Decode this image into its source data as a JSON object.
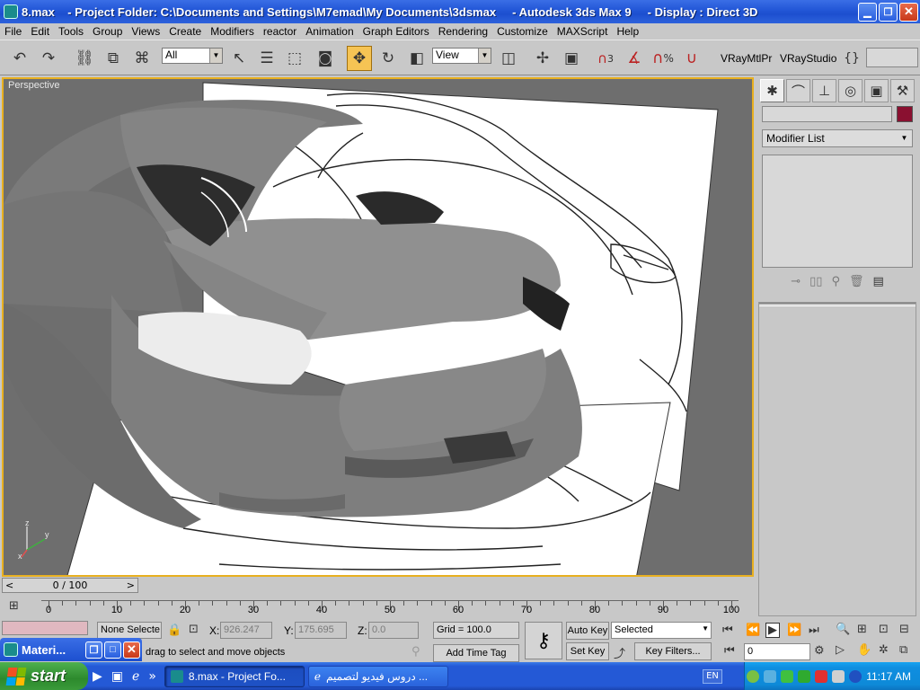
{
  "window": {
    "title": "8.max    - Project Folder: C:\\Documents and Settings\\M7emad\\My Documents\\3dsmax     - Autodesk 3ds Max 9     - Display : Direct 3D"
  },
  "menu": [
    "File",
    "Edit",
    "Tools",
    "Group",
    "Views",
    "Create",
    "Modifiers",
    "reactor",
    "Animation",
    "Graph Editors",
    "Rendering",
    "Customize",
    "MAXScript",
    "Help"
  ],
  "toolbar": {
    "selection_filter": "All",
    "reference_coord": "View",
    "vray_mtl_label": "VRayMtlPr",
    "vray_studio_label": "VRayStudio",
    "snap_angle_label": "3",
    "percent_snap_label": "%",
    "named_selection_value": ""
  },
  "viewport": {
    "label": "Perspective",
    "axis_x": "x",
    "axis_y": "y",
    "axis_z": "z",
    "object_color": "#8a1030"
  },
  "command_panel": {
    "name_value": "",
    "modifier_list": "Modifier List"
  },
  "time_slider": {
    "label": "0 / 100",
    "prev": "<",
    "next": ">"
  },
  "track": {
    "ticks": [
      "0",
      "10",
      "20",
      "30",
      "40",
      "50",
      "60",
      "70",
      "80",
      "90",
      "100"
    ]
  },
  "status": {
    "selection_info": "None Selecte",
    "prompt": "drag to select and move objects",
    "x_label": "X:",
    "x_value": "926.247",
    "y_label": "Y:",
    "y_value": "175.695",
    "z_label": "Z:",
    "z_value": "0.0",
    "grid": "Grid = 100.0",
    "add_time_tag": "Add Time Tag",
    "auto_key": "Auto Key",
    "set_key": "Set Key",
    "key_mode": "Selected",
    "key_filters": "Key Filters...",
    "frame_value": "0"
  },
  "float_window": {
    "title": "Materi..."
  },
  "taskbar": {
    "start": "start",
    "items": [
      "8.max    - Project Fo...",
      "دروس فيديو لتصميم ..."
    ],
    "language": "EN",
    "clock": "11:17 AM"
  }
}
